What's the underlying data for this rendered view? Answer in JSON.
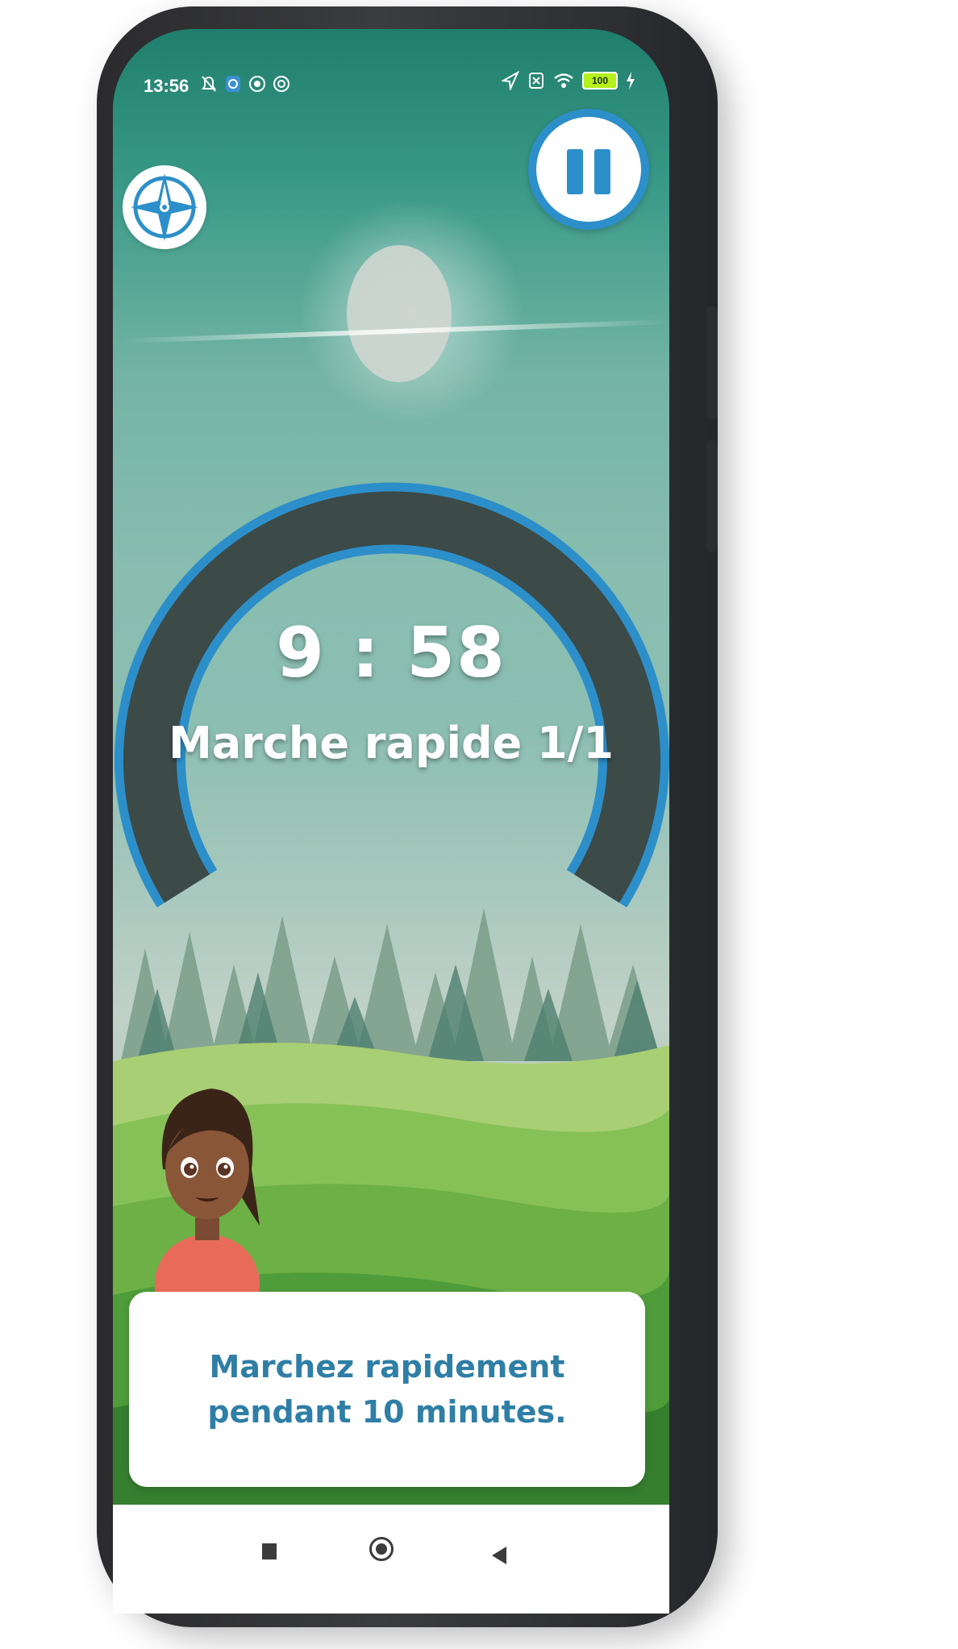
{
  "status_bar": {
    "time": "13:56",
    "battery": "100"
  },
  "workout": {
    "timer": "9 : 58",
    "activity": "Marche rapide 1/1",
    "instruction": "Marchez rapidement pendant 10 minutes."
  },
  "icons": {
    "compass": "compass-icon",
    "pause": "pause-icon",
    "nav_recent": "square-icon",
    "nav_home": "circle-icon",
    "nav_back": "triangle-back-icon"
  },
  "colors": {
    "accent": "#2d8fc9",
    "ring_track": "#3c4a48",
    "instruction_text": "#2f7ea6"
  }
}
